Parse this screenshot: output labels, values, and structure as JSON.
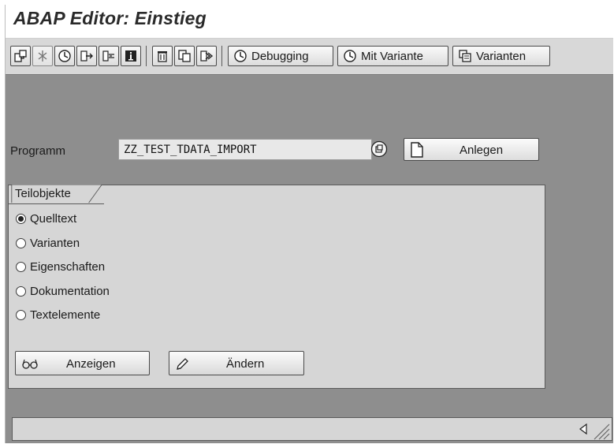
{
  "window": {
    "title": "ABAP Editor: Einstieg"
  },
  "toolbar": {
    "icons": [
      "other-object-icon",
      "activate-icon",
      "direct-processing-icon",
      "test-icon",
      "where-used-icon",
      "info-icon",
      "delete-icon",
      "copy-icon",
      "rename-icon"
    ],
    "debugging_label": "Debugging",
    "mit_variante_label": "Mit Variante",
    "varianten_label": "Varianten"
  },
  "form": {
    "program_label": "Programm",
    "program_value": "ZZ_TEST_TDATA_IMPORT",
    "create_label": "Anlegen"
  },
  "subobjects": {
    "title": "Teilobjekte",
    "options": [
      {
        "label": "Quelltext",
        "selected": true
      },
      {
        "label": "Varianten",
        "selected": false
      },
      {
        "label": "Eigenschaften",
        "selected": false
      },
      {
        "label": "Dokumentation",
        "selected": false
      },
      {
        "label": "Textelemente",
        "selected": false
      }
    ],
    "display_label": "Anzeigen",
    "change_label": "Ändern"
  },
  "colors": {
    "background": "#8e8e8e",
    "panel": "#d6d6d6",
    "toolbar": "#d8d8d8"
  }
}
